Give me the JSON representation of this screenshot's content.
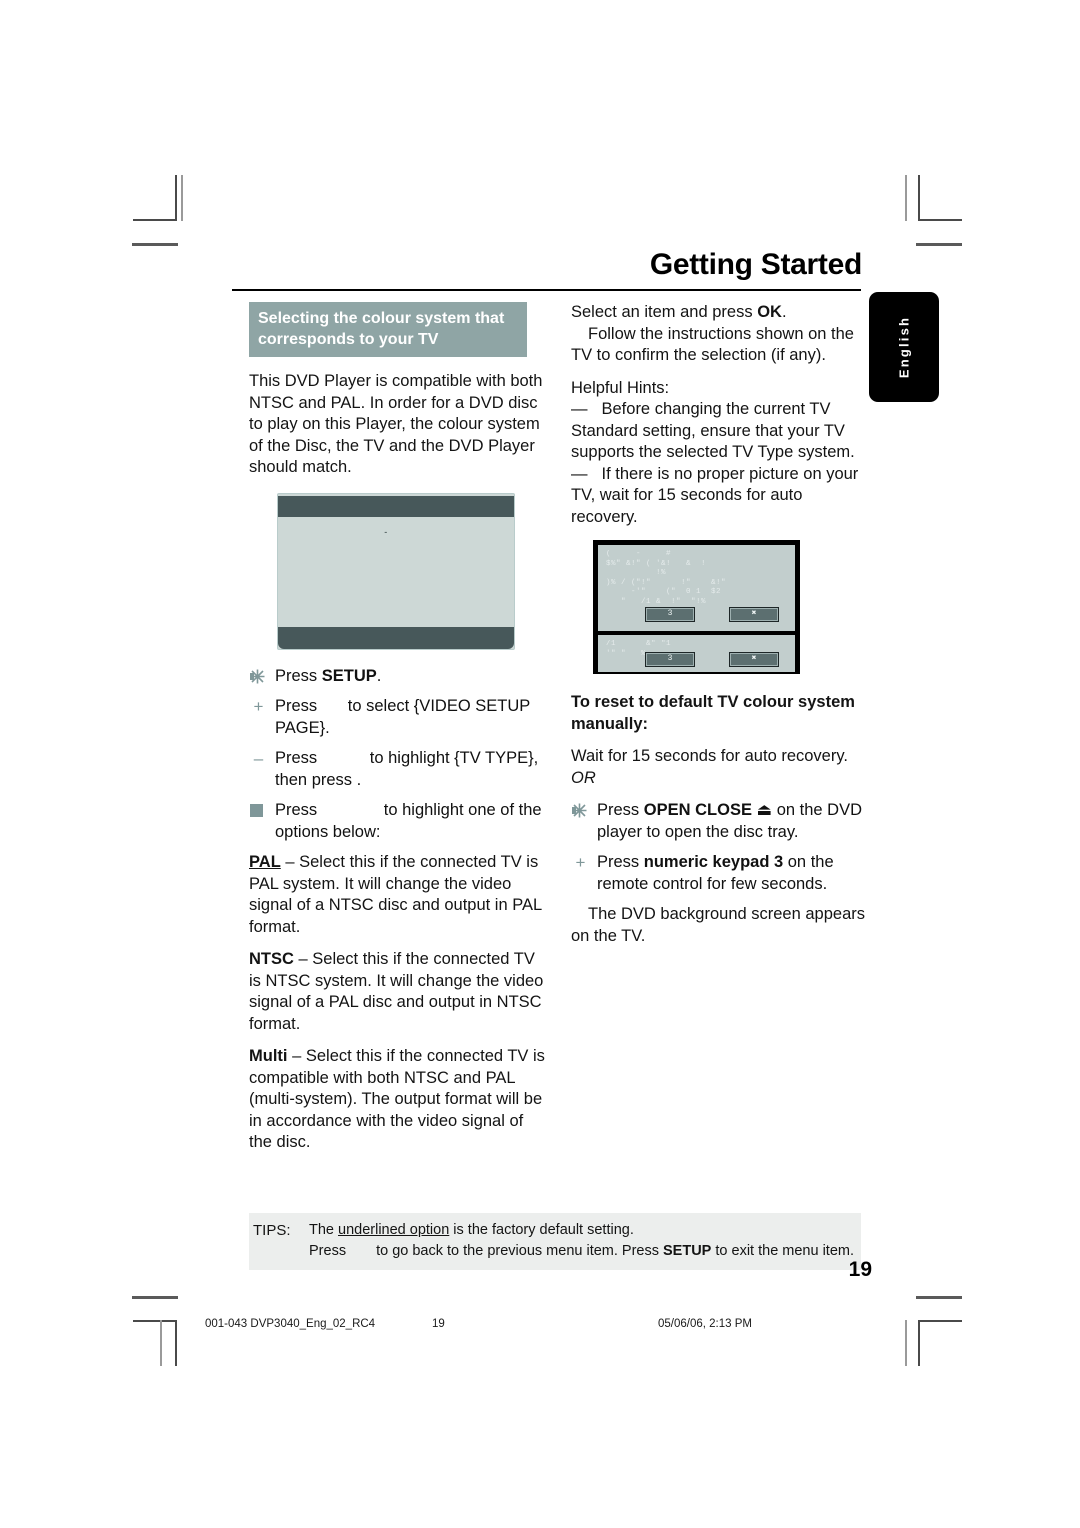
{
  "page": {
    "title": "Getting Started",
    "side_tab": "English",
    "page_number": "19"
  },
  "left_column": {
    "section_heading": "Selecting the colour system that corresponds to your TV",
    "intro": "This DVD Player is compatible with both NTSC and PAL. In order for a DVD disc to play on this Player, the colour system of the Disc, the TV and the DVD Player should match.",
    "screen_caption": "-",
    "steps": [
      {
        "marker": "star-icon",
        "text_before": "Press ",
        "bold": "SETUP",
        "text_after": "."
      },
      {
        "marker": "plus-icon",
        "text_before": "Press ",
        "gap": "",
        "text_after": "to select {VIDEO SETUP PAGE}."
      },
      {
        "marker": "dash-icon",
        "text_before": "Press ",
        "gap": "",
        "text_after": "to highlight {TV TYPE}, then press ."
      },
      {
        "marker": "square-icon",
        "text_before": "Press ",
        "gap": "",
        "text_after": "to highlight one of the options below:"
      }
    ],
    "options": [
      {
        "name": "PAL",
        "underlined": true,
        "body": " – Select this if the connected TV is PAL system. It will change the video signal of a NTSC disc and output in PAL format."
      },
      {
        "name": "NTSC",
        "underlined": false,
        "body": " – Select this if the connected TV is NTSC system. It will change the video signal of a PAL disc and output in NTSC format."
      },
      {
        "name": "Multi",
        "underlined": false,
        "body": " – Select this if the connected TV is compatible with both NTSC and PAL (multi-system). The output format will be in accordance with the video signal of the disc."
      }
    ]
  },
  "right_column": {
    "para_1": "Select an item and press ",
    "para_1_bold": "OK",
    "para_1_end": ".",
    "para_2": "Follow the instructions shown on the TV to confirm the selection (if any).",
    "hints_title": "Helpful Hints:",
    "hint_1": "Before changing the current TV Standard setting, ensure that your TV supports the  selected TV Type  system.",
    "hint_2": "If there is no proper picture on your TV, wait for 15 seconds for auto recovery.",
    "screen": {
      "dialog_1_text": "(     -     #\n$%\" &!\" ( '&!   &  !\n          !%\n)% / (\"!\"      !\"    &!\"\n     -'\"    (\"  0 1  $2\n   \"   /1 &  !\"  \"!%",
      "dialog_2_text": "/1      &\" \"1\n'\" \"   %",
      "button_1_label": "3",
      "button_2_label": "✖"
    },
    "reset_heading": "To reset to default TV colour system manually:",
    "reset_line_1": "Wait for 15 seconds for auto recovery.",
    "reset_or": "OR",
    "reset_step_1_before": "Press ",
    "reset_step_1_bold": "OPEN CLOSE",
    "reset_step_1_eject": "⏏",
    "reset_step_1_after": " on the DVD player to open the disc tray.",
    "reset_step_2_before": "Press ",
    "reset_step_2_bold": "numeric keypad  3",
    "reset_step_2_after": "  on the remote control for few seconds.",
    "reset_step_2_result": "The DVD background screen appears on the TV."
  },
  "tips": {
    "label": "TIPS:",
    "line_1_before": "The ",
    "line_1_underlined": "underlined option",
    "line_1_after": " is the factory default setting.",
    "line_2_before": "Press ",
    "line_2_mid": "to go back to the previous menu item. Press ",
    "line_2_bold": "SETUP",
    "line_2_after": " to exit the menu item."
  },
  "footer": {
    "file_name": "001-043 DVP3040_Eng_02_RC4",
    "page_number": "19",
    "timestamp": "05/06/06, 2:13 PM"
  },
  "colors": {
    "heading_bar": "#8fa5a5",
    "marker": "#7f9799",
    "screen_bar": "#47585a",
    "screen_body": "#cdd8d6",
    "tips_bg": "#eceeed",
    "tab_bg": "#000000"
  }
}
